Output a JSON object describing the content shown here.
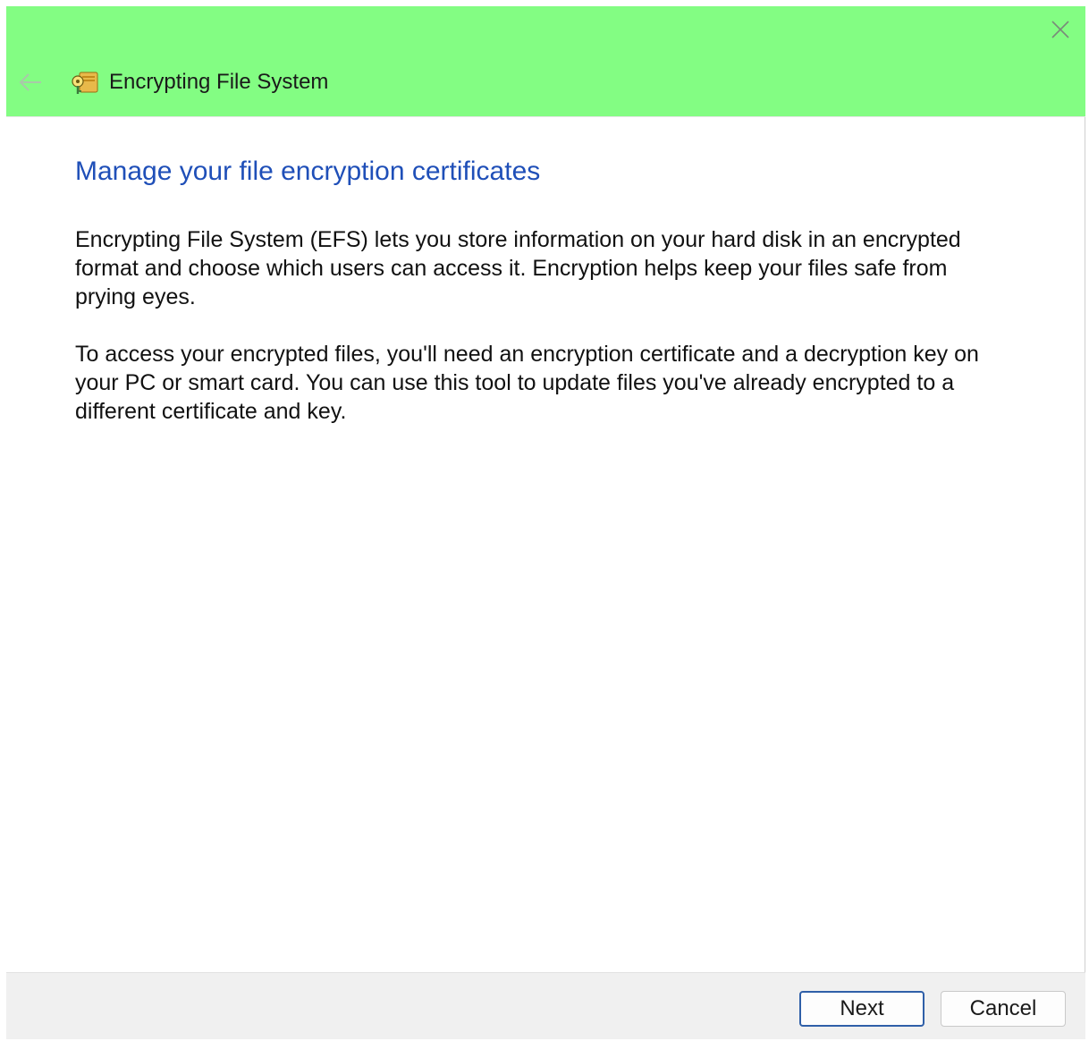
{
  "window": {
    "title": "Encrypting File System",
    "icons": {
      "app": "certificate-key-icon",
      "back": "back-arrow-icon",
      "close": "close-icon"
    },
    "colors": {
      "titlebar": "#83fd83",
      "heading": "#1f4fb8",
      "default_button_border": "#2f5fa8"
    }
  },
  "main": {
    "heading": "Manage your file encryption certificates",
    "paragraph1": "Encrypting File System (EFS) lets you store information on your hard disk in an encrypted format and choose which users can access it. Encryption helps keep your files safe from prying eyes.",
    "paragraph2": "To access your encrypted files, you'll need an encryption certificate and a decryption key on your PC or smart card. You can use this tool to update files you've already encrypted to a different certificate and key."
  },
  "footer": {
    "next_label": "Next",
    "cancel_label": "Cancel"
  }
}
